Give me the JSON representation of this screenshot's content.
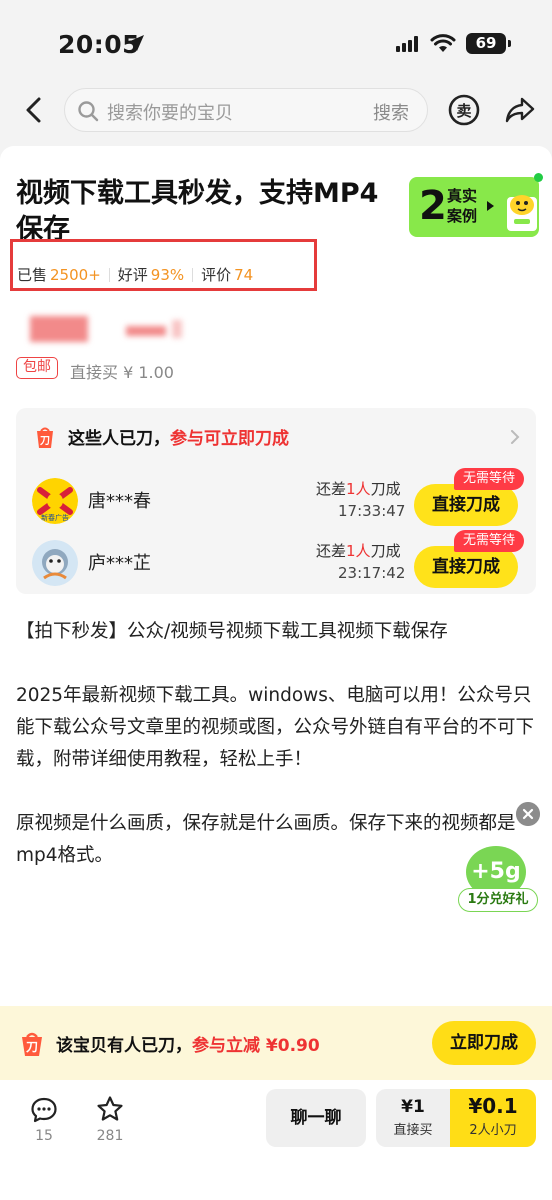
{
  "status_bar": {
    "time": "20:05",
    "battery": "69"
  },
  "nav": {
    "search_placeholder": "搜索你要的宝贝",
    "search_button": "搜索",
    "sell_icon": "sell-icon",
    "share_icon": "share-icon"
  },
  "product": {
    "title": "视频下载工具秒发，支持MP4保存",
    "cases_count": "2",
    "cases_label": "真实案例",
    "stats": [
      {
        "label": "已售",
        "value": "2500+"
      },
      {
        "label": "好评",
        "value": "93%"
      },
      {
        "label": "评价",
        "value": "74"
      }
    ],
    "shipping_tag": "包邮",
    "direct_buy_price": "直接买 ¥ 1.00"
  },
  "cut_section": {
    "heading_black": "这些人已刀，",
    "heading_red": "参与可立即刀成",
    "rows": [
      {
        "name": "唐***春",
        "remain_prefix": "还差",
        "remain_count": "1人",
        "remain_suffix": "刀成",
        "timer": "17:33:47",
        "button": "直接刀成",
        "tag": "无需等待"
      },
      {
        "name": "庐***芷",
        "remain_prefix": "还差",
        "remain_count": "1人",
        "remain_suffix": "刀成",
        "timer": "23:17:42",
        "button": "直接刀成",
        "tag": "无需等待"
      }
    ]
  },
  "description": {
    "p1": "【拍下秒发】公众/视频号视频下载工具视频下载保存",
    "p2": "2025年最新视频下载工具。windows、电脑可以用！公众号只能下载公众号文章里的视频或图，公众号外链自有平台的不可下载，附带详细使用教程，轻松上手！",
    "p3": "原视频是什么画质，保存就是什么画质。保存下来的视频都是mp4格式。"
  },
  "bonus": {
    "amount": "+5g",
    "label": "1分兑好礼"
  },
  "banner": {
    "text_black": "该宝贝有人已刀，",
    "text_red": "参与立减 ¥0.90",
    "button": "立即刀成"
  },
  "action_bar": {
    "comments_count": "15",
    "favorites_count": "281",
    "chat_label": "聊一聊",
    "direct_price": "¥1",
    "direct_label": "直接买",
    "cut_price": "¥0.1",
    "cut_label": "2人小刀"
  },
  "colors": {
    "accent_yellow": "#ffdd16",
    "accent_red": "#ee3333",
    "stat_orange": "#f39322",
    "cases_green": "#88e84a"
  }
}
